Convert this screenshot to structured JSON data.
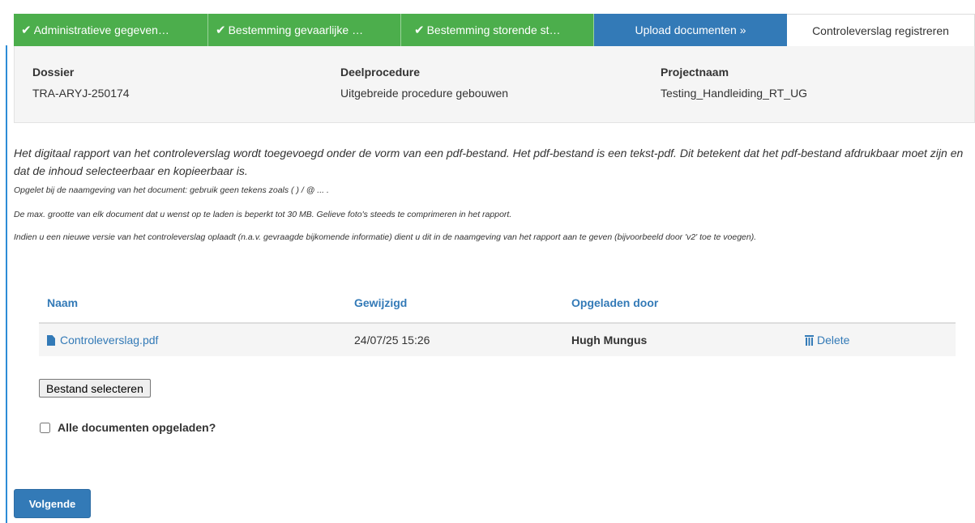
{
  "steps": [
    {
      "label": "Administratieve gegeven…",
      "state": "done"
    },
    {
      "label": "Bestemming gevaarlijke …",
      "state": "done"
    },
    {
      "label": "Bestemming storende st…",
      "state": "done"
    },
    {
      "label": "Upload documenten »",
      "state": "active"
    },
    {
      "label": "Controleverslag registreren",
      "state": "todo"
    }
  ],
  "check_glyph": "✔",
  "info": {
    "dossier": {
      "label": "Dossier",
      "value": "TRA-ARYJ-250174"
    },
    "deelprocedure": {
      "label": "Deelprocedure",
      "value": "Uitgebreide procedure gebouwen"
    },
    "projectnaam": {
      "label": "Projectnaam",
      "value": "Testing_Handleiding_RT_UG"
    }
  },
  "description": "Het digitaal rapport van het controleverslag wordt toegevoegd onder de vorm van een pdf-bestand. Het pdf-bestand is een tekst-pdf. Dit betekent dat het pdf-bestand afdrukbaar moet zijn en dat de inhoud selecteerbaar en kopieerbaar is.",
  "notes": [
    "Opgelet bij de naamgeving van het document: gebruik geen tekens zoals ( ) / @ ... .",
    "De max. grootte van elk document dat u wenst op te laden is beperkt tot 30 MB. Gelieve foto's steeds te comprimeren in het rapport.",
    "Indien u een nieuwe versie van het controleverslag oplaadt (n.a.v. gevraagde bijkomende informatie) dient u dit in de naamgeving van het rapport aan te geven (bijvoorbeeld door 'v2' toe te voegen)."
  ],
  "table": {
    "headers": {
      "name": "Naam",
      "modified": "Gewijzigd",
      "uploaded_by": "Opgeladen door"
    },
    "rows": [
      {
        "name": "Controleverslag.pdf",
        "modified": "24/07/25 15:26",
        "uploaded_by": "Hugh Mungus",
        "action": "Delete"
      }
    ]
  },
  "select_file_label": "Bestand selecteren",
  "all_uploaded_label": "Alle documenten opgeladen?",
  "all_uploaded_checked": false,
  "next_label": "Volgende",
  "colors": {
    "done": "#4cae4c",
    "active": "#337ab7",
    "link": "#337ab7"
  },
  "icons": {
    "step_done": "check-icon",
    "file": "file-icon",
    "delete": "trash-icon"
  }
}
